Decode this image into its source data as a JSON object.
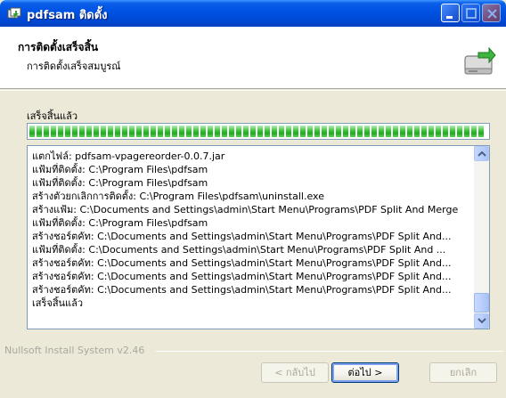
{
  "window": {
    "title": "pdfsam ติดตั้ง"
  },
  "header": {
    "title": "การติดตั้งเสร็จสิ้น",
    "subtitle": "การติดตั้งเสร็จสมบูรณ์",
    "icon": "installer-complete-icon"
  },
  "progress": {
    "status_label": "เสร็จสิ้นแล้ว",
    "fraction": 1.0,
    "color": "#21a821"
  },
  "details": {
    "lines": [
      "แตกไฟล์: pdfsam-vpagereorder-0.0.7.jar",
      "แฟ้มที่ติดตั้ง: C:\\Program Files\\pdfsam",
      "แฟ้มที่ติดตั้ง: C:\\Program Files\\pdfsam",
      "สร้างตัวยกเลิกการติดตั้ง: C:\\Program Files\\pdfsam\\uninstall.exe",
      "สร้างแฟ้ม: C:\\Documents and Settings\\admin\\Start Menu\\Programs\\PDF Split And Merge",
      "แฟ้มที่ติดตั้ง: C:\\Program Files\\pdfsam",
      "สร้างชอร์ตคัท: C:\\Documents and Settings\\admin\\Start Menu\\Programs\\PDF Split And...",
      "แฟ้มที่ติดตั้ง: C:\\Documents and Settings\\admin\\Start Menu\\Programs\\PDF Split And ...",
      "สร้างชอร์ตคัท: C:\\Documents and Settings\\admin\\Start Menu\\Programs\\PDF Split And...",
      "สร้างชอร์ตคัท: C:\\Documents and Settings\\admin\\Start Menu\\Programs\\PDF Split And...",
      "สร้างชอร์ตคัท: C:\\Documents and Settings\\admin\\Start Menu\\Programs\\PDF Split And...",
      "เสร็จสิ้นแล้ว"
    ]
  },
  "footer": {
    "branding": "Nullsoft Install System v2.46",
    "back_label": "< กลับไป",
    "next_label": "ต่อไป >",
    "cancel_label": "ยกเลิก"
  },
  "colors": {
    "titlebar": "#0054e3",
    "dialog_bg": "#ece9d8",
    "field_border": "#7f9db9"
  }
}
